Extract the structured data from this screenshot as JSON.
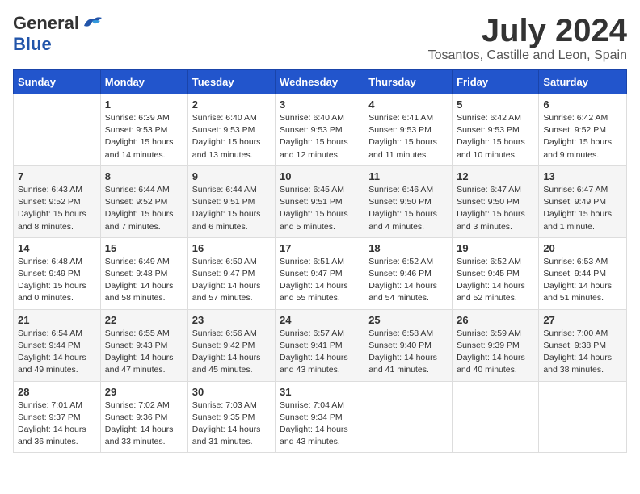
{
  "header": {
    "logo_general": "General",
    "logo_blue": "Blue",
    "month_title": "July 2024",
    "location": "Tosantos, Castille and Leon, Spain"
  },
  "days_of_week": [
    "Sunday",
    "Monday",
    "Tuesday",
    "Wednesday",
    "Thursday",
    "Friday",
    "Saturday"
  ],
  "weeks": [
    [
      {
        "day": "",
        "info": ""
      },
      {
        "day": "1",
        "info": "Sunrise: 6:39 AM\nSunset: 9:53 PM\nDaylight: 15 hours\nand 14 minutes."
      },
      {
        "day": "2",
        "info": "Sunrise: 6:40 AM\nSunset: 9:53 PM\nDaylight: 15 hours\nand 13 minutes."
      },
      {
        "day": "3",
        "info": "Sunrise: 6:40 AM\nSunset: 9:53 PM\nDaylight: 15 hours\nand 12 minutes."
      },
      {
        "day": "4",
        "info": "Sunrise: 6:41 AM\nSunset: 9:53 PM\nDaylight: 15 hours\nand 11 minutes."
      },
      {
        "day": "5",
        "info": "Sunrise: 6:42 AM\nSunset: 9:53 PM\nDaylight: 15 hours\nand 10 minutes."
      },
      {
        "day": "6",
        "info": "Sunrise: 6:42 AM\nSunset: 9:52 PM\nDaylight: 15 hours\nand 9 minutes."
      }
    ],
    [
      {
        "day": "7",
        "info": "Sunrise: 6:43 AM\nSunset: 9:52 PM\nDaylight: 15 hours\nand 8 minutes."
      },
      {
        "day": "8",
        "info": "Sunrise: 6:44 AM\nSunset: 9:52 PM\nDaylight: 15 hours\nand 7 minutes."
      },
      {
        "day": "9",
        "info": "Sunrise: 6:44 AM\nSunset: 9:51 PM\nDaylight: 15 hours\nand 6 minutes."
      },
      {
        "day": "10",
        "info": "Sunrise: 6:45 AM\nSunset: 9:51 PM\nDaylight: 15 hours\nand 5 minutes."
      },
      {
        "day": "11",
        "info": "Sunrise: 6:46 AM\nSunset: 9:50 PM\nDaylight: 15 hours\nand 4 minutes."
      },
      {
        "day": "12",
        "info": "Sunrise: 6:47 AM\nSunset: 9:50 PM\nDaylight: 15 hours\nand 3 minutes."
      },
      {
        "day": "13",
        "info": "Sunrise: 6:47 AM\nSunset: 9:49 PM\nDaylight: 15 hours\nand 1 minute."
      }
    ],
    [
      {
        "day": "14",
        "info": "Sunrise: 6:48 AM\nSunset: 9:49 PM\nDaylight: 15 hours\nand 0 minutes."
      },
      {
        "day": "15",
        "info": "Sunrise: 6:49 AM\nSunset: 9:48 PM\nDaylight: 14 hours\nand 58 minutes."
      },
      {
        "day": "16",
        "info": "Sunrise: 6:50 AM\nSunset: 9:47 PM\nDaylight: 14 hours\nand 57 minutes."
      },
      {
        "day": "17",
        "info": "Sunrise: 6:51 AM\nSunset: 9:47 PM\nDaylight: 14 hours\nand 55 minutes."
      },
      {
        "day": "18",
        "info": "Sunrise: 6:52 AM\nSunset: 9:46 PM\nDaylight: 14 hours\nand 54 minutes."
      },
      {
        "day": "19",
        "info": "Sunrise: 6:52 AM\nSunset: 9:45 PM\nDaylight: 14 hours\nand 52 minutes."
      },
      {
        "day": "20",
        "info": "Sunrise: 6:53 AM\nSunset: 9:44 PM\nDaylight: 14 hours\nand 51 minutes."
      }
    ],
    [
      {
        "day": "21",
        "info": "Sunrise: 6:54 AM\nSunset: 9:44 PM\nDaylight: 14 hours\nand 49 minutes."
      },
      {
        "day": "22",
        "info": "Sunrise: 6:55 AM\nSunset: 9:43 PM\nDaylight: 14 hours\nand 47 minutes."
      },
      {
        "day": "23",
        "info": "Sunrise: 6:56 AM\nSunset: 9:42 PM\nDaylight: 14 hours\nand 45 minutes."
      },
      {
        "day": "24",
        "info": "Sunrise: 6:57 AM\nSunset: 9:41 PM\nDaylight: 14 hours\nand 43 minutes."
      },
      {
        "day": "25",
        "info": "Sunrise: 6:58 AM\nSunset: 9:40 PM\nDaylight: 14 hours\nand 41 minutes."
      },
      {
        "day": "26",
        "info": "Sunrise: 6:59 AM\nSunset: 9:39 PM\nDaylight: 14 hours\nand 40 minutes."
      },
      {
        "day": "27",
        "info": "Sunrise: 7:00 AM\nSunset: 9:38 PM\nDaylight: 14 hours\nand 38 minutes."
      }
    ],
    [
      {
        "day": "28",
        "info": "Sunrise: 7:01 AM\nSunset: 9:37 PM\nDaylight: 14 hours\nand 36 minutes."
      },
      {
        "day": "29",
        "info": "Sunrise: 7:02 AM\nSunset: 9:36 PM\nDaylight: 14 hours\nand 33 minutes."
      },
      {
        "day": "30",
        "info": "Sunrise: 7:03 AM\nSunset: 9:35 PM\nDaylight: 14 hours\nand 31 minutes."
      },
      {
        "day": "31",
        "info": "Sunrise: 7:04 AM\nSunset: 9:34 PM\nDaylight: 14 hours\nand 43 minutes."
      },
      {
        "day": "",
        "info": ""
      },
      {
        "day": "",
        "info": ""
      },
      {
        "day": "",
        "info": ""
      }
    ]
  ]
}
